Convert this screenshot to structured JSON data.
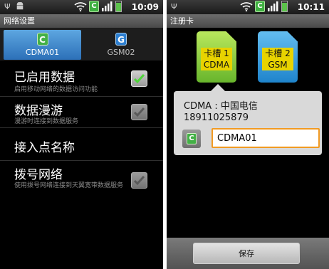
{
  "left_screen": {
    "status_time": "10:09",
    "sim_status_icon": "C",
    "title": "网络设置",
    "tabs": [
      {
        "icon": "C",
        "label": "CDMA01",
        "selected": true
      },
      {
        "icon": "G",
        "label": "GSM02",
        "selected": false
      }
    ],
    "settings": [
      {
        "title": "已启用数据",
        "subtitle": "启用移动网络的数据访问功能",
        "checked": true,
        "enabled": true
      },
      {
        "title": "数据漫游",
        "subtitle": "漫游时连接到数据服务",
        "checked": true,
        "enabled": false
      },
      {
        "title": "接入点名称",
        "subtitle": ""
      },
      {
        "title": "拨号网络",
        "subtitle": "使用拨号网络连接到天翼宽带数据服务",
        "checked": true,
        "enabled": false
      }
    ]
  },
  "right_screen": {
    "status_time": "10:11",
    "sim_status_icon": "C",
    "title": "注册卡",
    "sim_cards": [
      {
        "line1": "卡槽 1",
        "line2": "CDMA",
        "color": "#7fc43a"
      },
      {
        "line1": "卡槽 2",
        "line2": "GSM",
        "color": "#2a93d6"
      }
    ],
    "dialog": {
      "carrier_line": "CDMA : 中国电信",
      "number": "18911025879",
      "sim_icon": "C",
      "name_value": "CDMA01"
    },
    "save_label": "保存"
  },
  "colors": {
    "cdma_green": "#43b046",
    "gsm_blue": "#2d7fd1",
    "tab_active": "#3f86cc",
    "input_focus": "#f19a22"
  },
  "icons": [
    "usb-icon",
    "android-icon",
    "wifi-icon",
    "sim-c-icon",
    "signal-icon",
    "battery-icon",
    "checkmark-icon"
  ]
}
